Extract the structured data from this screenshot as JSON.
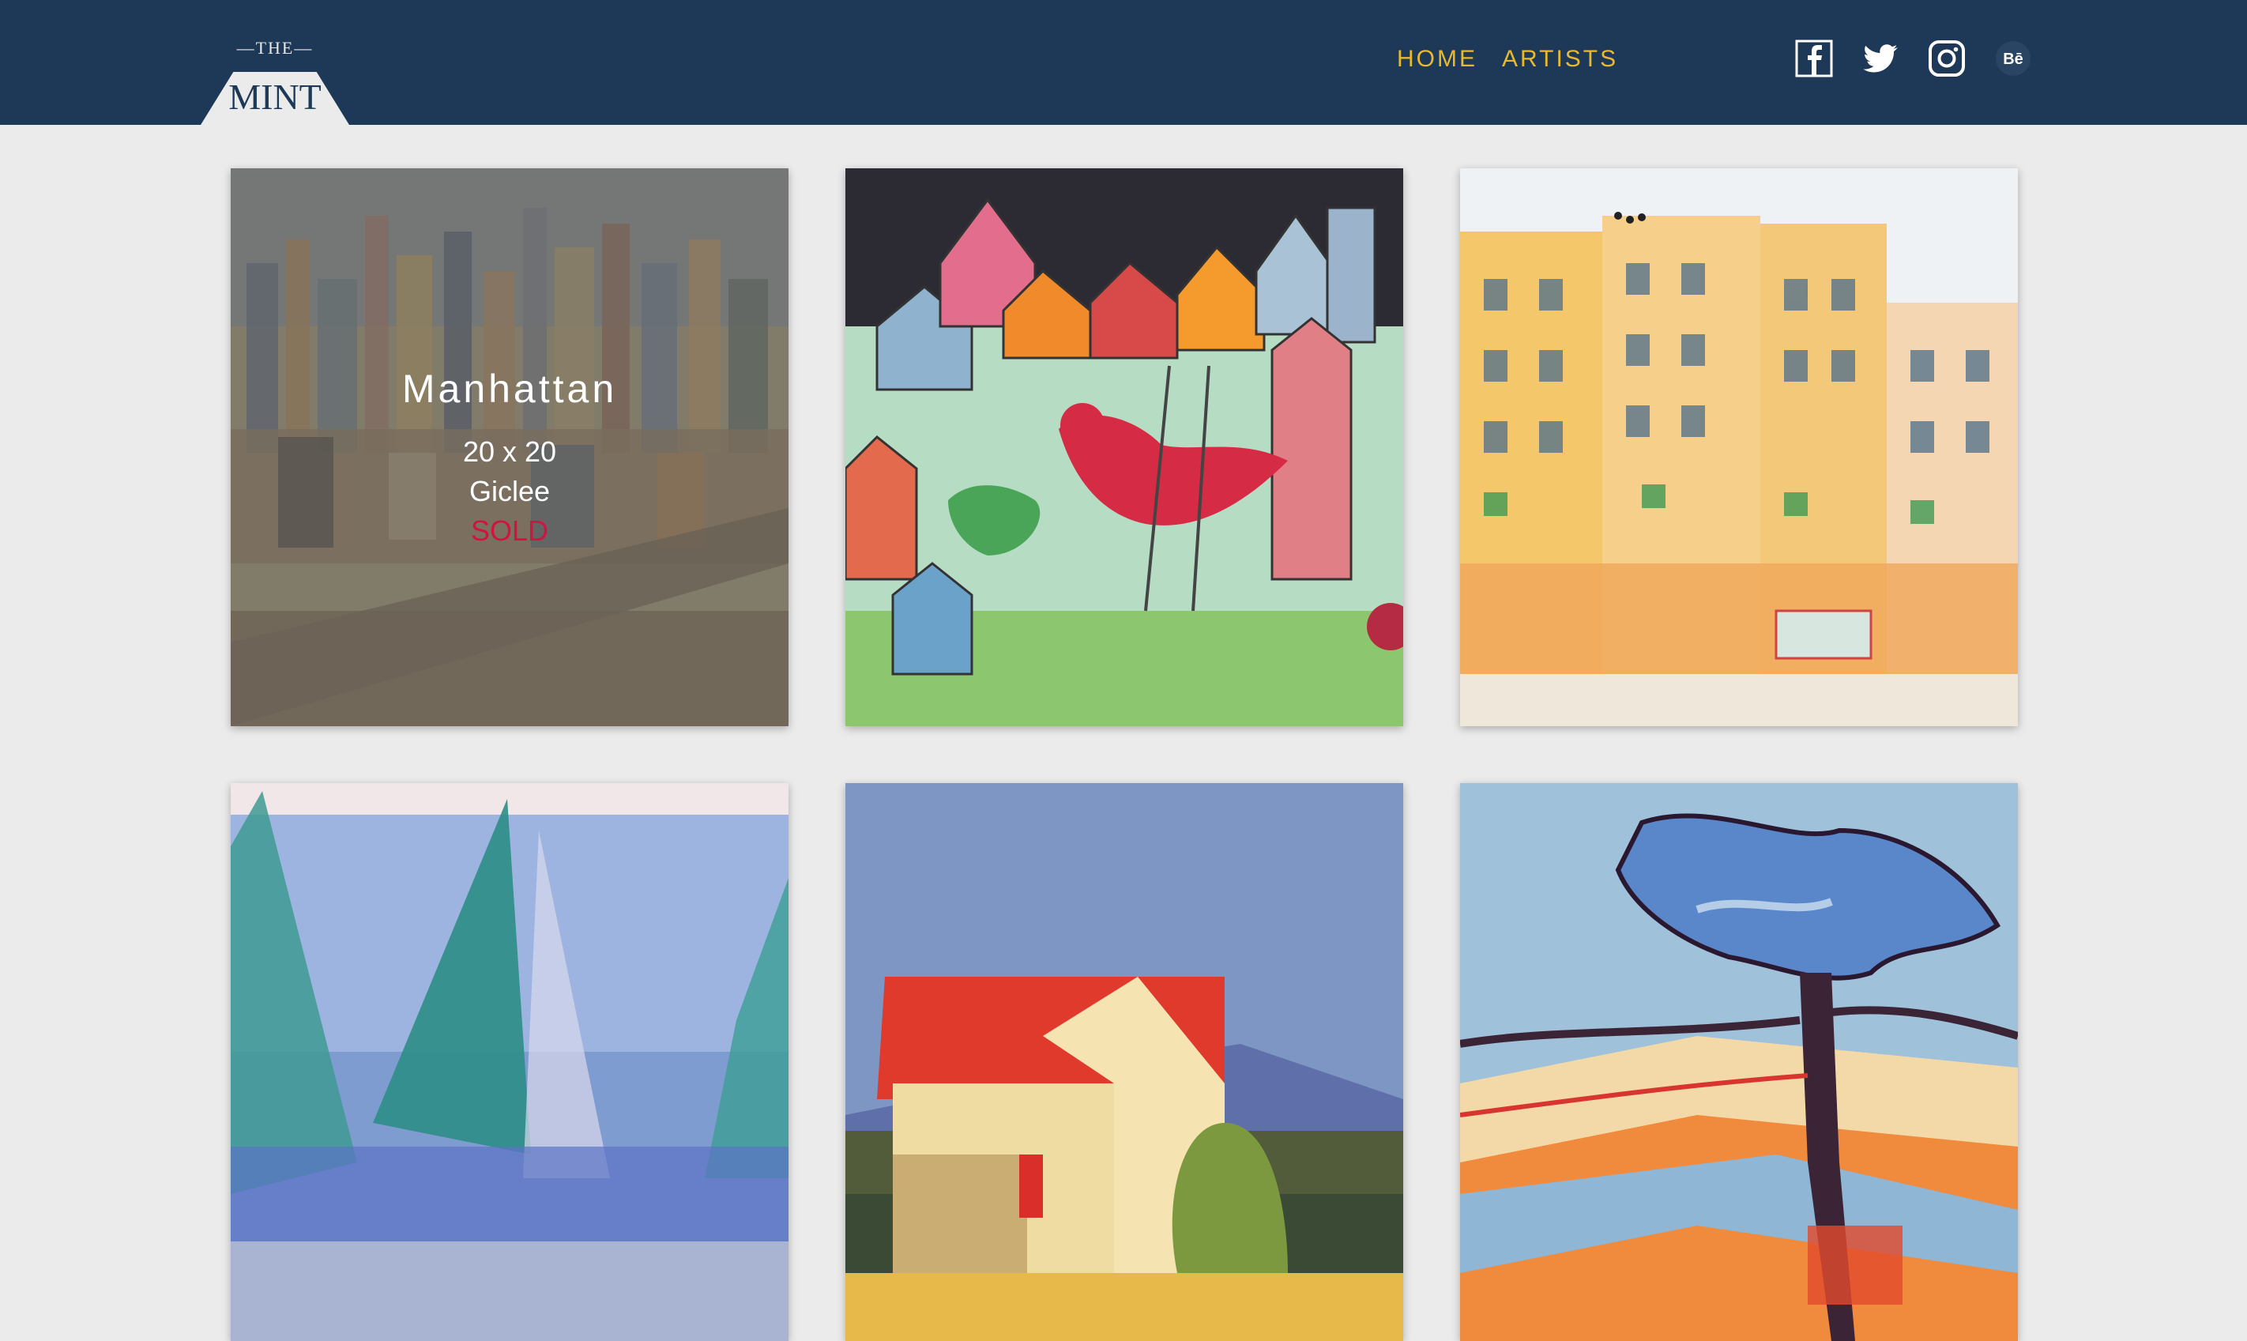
{
  "brand": {
    "top": "—THE—",
    "name": "MINT"
  },
  "nav": {
    "items": [
      {
        "label": "HOME"
      },
      {
        "label": "ARTISTS"
      }
    ],
    "accent_color": "#e8b92d"
  },
  "social": {
    "icons": [
      "facebook-icon",
      "twitter-icon",
      "instagram-icon",
      "behance-icon"
    ],
    "behance_glyph": "Bē"
  },
  "colors": {
    "header_bg": "#1d3957",
    "page_bg": "#ebebeb",
    "sold": "#d3133f"
  },
  "gallery": {
    "items": [
      {
        "title": "Manhattan",
        "size": "20 x 20",
        "medium": "Giclee",
        "status": "SOLD",
        "hover": true
      },
      {
        "hover": false
      },
      {
        "hover": false
      },
      {
        "hover": false
      },
      {
        "hover": false
      },
      {
        "hover": false
      }
    ]
  }
}
